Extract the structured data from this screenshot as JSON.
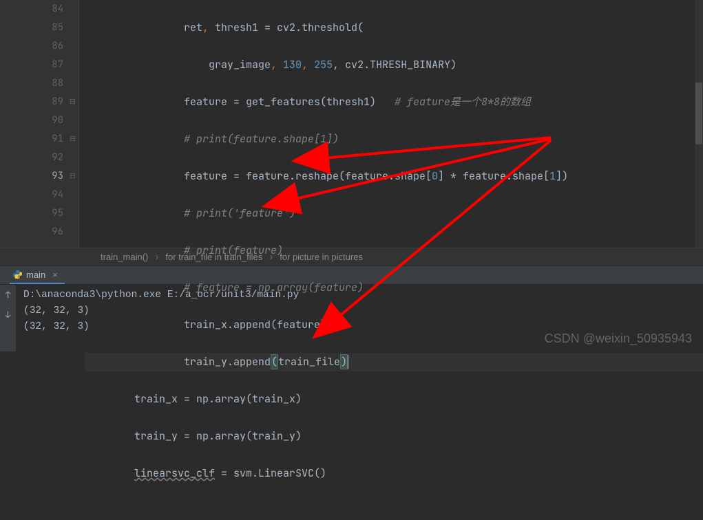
{
  "gutter": {
    "start": 84,
    "end": 96,
    "current": 93
  },
  "code": {
    "l84": {
      "indent": "                ",
      "t1": "ret",
      "t2": ", ",
      "t3": "thresh1 = cv2.threshold("
    },
    "l85": {
      "indent": "                    ",
      "t1": "gray_image",
      "t2": ", ",
      "n1": "130",
      "t3": ", ",
      "n2": "255",
      "t4": ", cv2.THRESH_BINARY)"
    },
    "l86": {
      "indent": "                ",
      "t1": "feature = get_features(thresh1)   ",
      "c1": "# feature是一个8*8的数组"
    },
    "l87": {
      "indent": "                ",
      "c1": "# print(feature.shape[1])"
    },
    "l88": {
      "indent": "                ",
      "t1": "feature = feature.reshape(feature.shape[",
      "n1": "0",
      "t2": "] * feature.shape[",
      "n2": "1",
      "t3": "])"
    },
    "l89": {
      "indent": "                ",
      "c1": "# print('feature')"
    },
    "l90": {
      "indent": "                ",
      "c1": "# print(feature)"
    },
    "l91": {
      "indent": "                ",
      "c1": "# feature = np.array(feature)"
    },
    "l92": {
      "indent": "                ",
      "t1": "train_x.append(feature)"
    },
    "l93": {
      "indent": "                ",
      "t1": "train_y.append",
      "p1": "(",
      "t2": "train_file",
      "p2": ")"
    },
    "l94": {
      "indent": "        ",
      "t1": "train_x = np.array(train_x)"
    },
    "l95": {
      "indent": "        ",
      "t1": "train_y = np.array(train_y)"
    },
    "l96": {
      "indent": "        ",
      "t1": "linearsvc_clf",
      "t2": " = svm.LinearSVC()"
    }
  },
  "breadcrumbs": {
    "b1": "train_main()",
    "b2": "for train_file in train_files",
    "b3": "for picture in pictures"
  },
  "tab": {
    "name": "main"
  },
  "console": {
    "l1": "D:\\anaconda3\\python.exe E:/a_ocr/unit3/main.py",
    "l2": "(32, 32, 3)",
    "l3": "(32, 32, 3)"
  },
  "watermark": "CSDN @weixin_50935943"
}
